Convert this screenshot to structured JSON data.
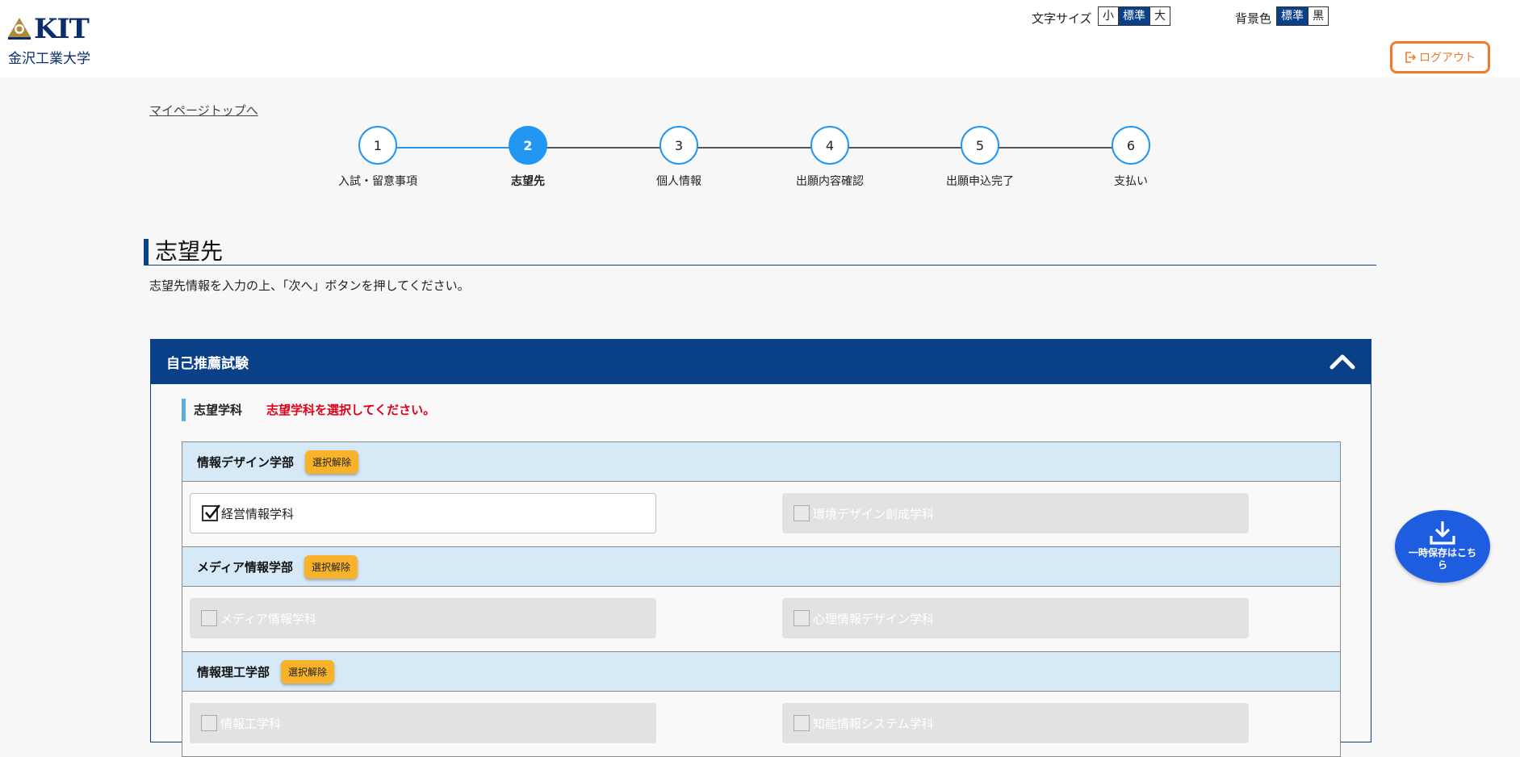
{
  "header": {
    "logo_text": "KIT",
    "university_name": "金沢工業大学",
    "font_size_label": "文字サイズ",
    "font_size_options": [
      "小",
      "標準",
      "大"
    ],
    "font_size_selected": "標準",
    "bg_color_label": "背景色",
    "bg_color_options": [
      "標準",
      "黒"
    ],
    "bg_color_selected": "標準",
    "logout_label": "ログアウト"
  },
  "breadcrumb": {
    "mypage_link": "マイページトップへ"
  },
  "steps": [
    {
      "number": "1",
      "label": "入試・留意事項"
    },
    {
      "number": "2",
      "label": "志望先"
    },
    {
      "number": "3",
      "label": "個人情報"
    },
    {
      "number": "4",
      "label": "出願内容確認"
    },
    {
      "number": "5",
      "label": "出願申込完了"
    },
    {
      "number": "6",
      "label": "支払い"
    }
  ],
  "current_step": 2,
  "main": {
    "title": "志望先",
    "instruction": "志望先情報を入力の上、「次へ」ボタンを押してください。"
  },
  "panel": {
    "title": "自己推薦試験",
    "section_label": "志望学科",
    "error_message": "志望学科を選択してください。",
    "deselect_label": "選択解除",
    "faculties": [
      {
        "name": "情報デザイン学部",
        "departments": [
          {
            "name": "経営情報学科",
            "checked": true,
            "enabled": true
          },
          {
            "name": "環境デザイン創成学科",
            "checked": false,
            "enabled": false
          }
        ]
      },
      {
        "name": "メディア情報学部",
        "departments": [
          {
            "name": "メディア情報学科",
            "checked": false,
            "enabled": false
          },
          {
            "name": "心理情報デザイン学科",
            "checked": false,
            "enabled": false
          }
        ]
      },
      {
        "name": "情報理工学部",
        "departments": [
          {
            "name": "情報工学科",
            "checked": false,
            "enabled": false
          },
          {
            "name": "知能情報システム学科",
            "checked": false,
            "enabled": false
          }
        ]
      }
    ]
  },
  "save_button": {
    "label": "一時保存はこちら"
  },
  "colors": {
    "primary_navy": "#0a4088",
    "step_blue": "#2196f3",
    "logout_orange": "#f07a2a",
    "deselect_yellow": "#f8b32a",
    "error_red": "#e0001a",
    "save_blue": "#1f5de0",
    "faculty_header_bg": "#d6e9f7"
  }
}
